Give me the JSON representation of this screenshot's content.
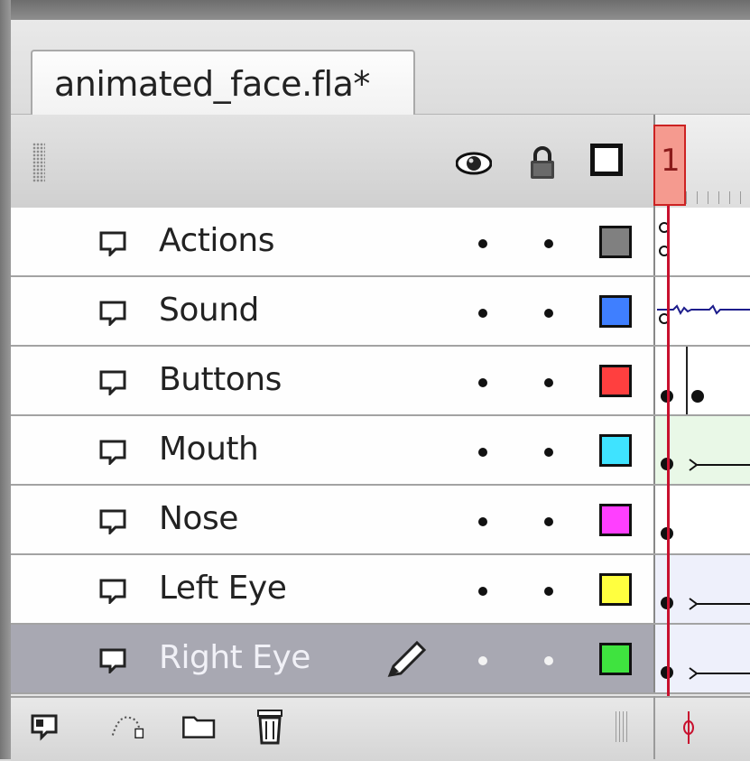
{
  "document_tab": {
    "title": "animated_face.fla*"
  },
  "header": {
    "icons": [
      "eye-icon",
      "lock-icon",
      "outline-icon"
    ],
    "playhead_frame": "1"
  },
  "layers": [
    {
      "name": "Actions",
      "color": "#808080",
      "selected": false
    },
    {
      "name": "Sound",
      "color": "#3f7fff",
      "selected": false
    },
    {
      "name": "Buttons",
      "color": "#ff3f3f",
      "selected": false
    },
    {
      "name": "Mouth",
      "color": "#3fe3ff",
      "selected": false
    },
    {
      "name": "Nose",
      "color": "#ff3fff",
      "selected": false
    },
    {
      "name": "Left Eye",
      "color": "#ffff3f",
      "selected": false
    },
    {
      "name": "Right Eye",
      "color": "#3fe33f",
      "selected": true
    }
  ],
  "footer": {
    "icons": [
      "new-layer-icon",
      "add-motion-guide-icon",
      "new-folder-icon",
      "delete-layer-icon",
      "onion-skin-icon"
    ]
  },
  "colors": {
    "playhead": "#c8102e",
    "playhead_fill": "#f59a8f",
    "selected_row": "#a8a8b2"
  }
}
